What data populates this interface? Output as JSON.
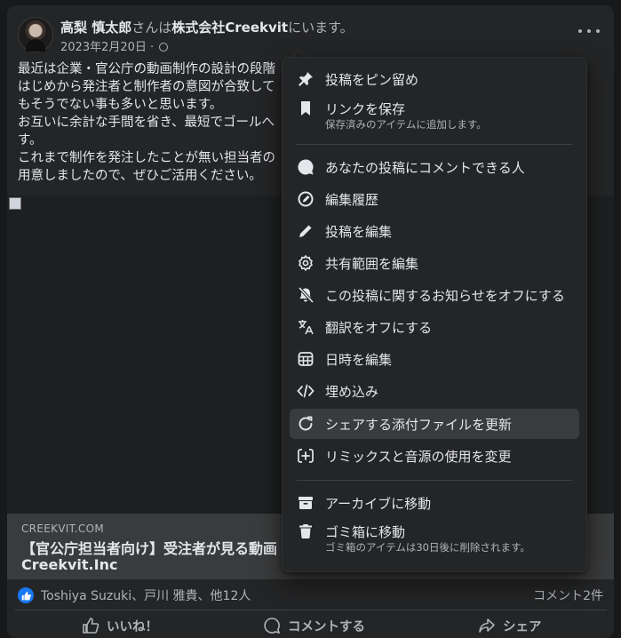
{
  "post": {
    "author": "高梨 慎太郎",
    "at_text": "さんは",
    "company": "株式会社Creekvit",
    "location_suffix": "にいます。",
    "date": "2023年2月20日",
    "separator": "·",
    "privacy_icon": "globe-icon",
    "text_lines": [
      "最近は企業・官公庁の動画制作の設計の段階",
      "はじめから発注者と制作者の意図が合致して",
      "もそうでない事も多いと思います。",
      "お互いに余計な手間を省き、最短でゴールへ",
      "す。",
      "これまで制作を発注したことが無い担当者の",
      "用意しましたので、ぜひご活用ください。"
    ]
  },
  "link_preview": {
    "domain": "CREEKVIT.COM",
    "title": "【官公庁担当者向け】受注者が見る動画",
    "title_line2": "Creekvit.Inc"
  },
  "reactions": {
    "names": "Toshiya Suzuki、戸川 雅貴、他12人",
    "comments": "コメント2件"
  },
  "actions": {
    "like": "いいね！",
    "comment": "コメントする",
    "share": "シェア"
  },
  "menu": {
    "pin": "投稿をピン留め",
    "save_link": "リンクを保存",
    "save_link_sub": "保存済みのアイテムに追加します。",
    "who_can_comment": "あなたの投稿にコメントできる人",
    "edit_history": "編集履歴",
    "edit_post": "投稿を編集",
    "edit_audience": "共有範囲を編集",
    "turn_off_notifications": "この投稿に関するお知らせをオフにする",
    "turn_off_translation": "翻訳をオフにする",
    "edit_date": "日時を編集",
    "embed": "埋め込み",
    "refresh_attachment": "シェアする添付ファイルを更新",
    "remix_settings": "リミックスと音源の使用を変更",
    "archive": "アーカイブに移動",
    "trash": "ゴミ箱に移動",
    "trash_sub": "ゴミ箱のアイテムは30日後に削除されます。"
  },
  "colors": {
    "background": "#18191a",
    "card": "#242526",
    "highlight": "#3a3b3c",
    "text": "#e4e6eb",
    "secondary": "#b0b3b8",
    "like_blue": "#1877f2"
  }
}
